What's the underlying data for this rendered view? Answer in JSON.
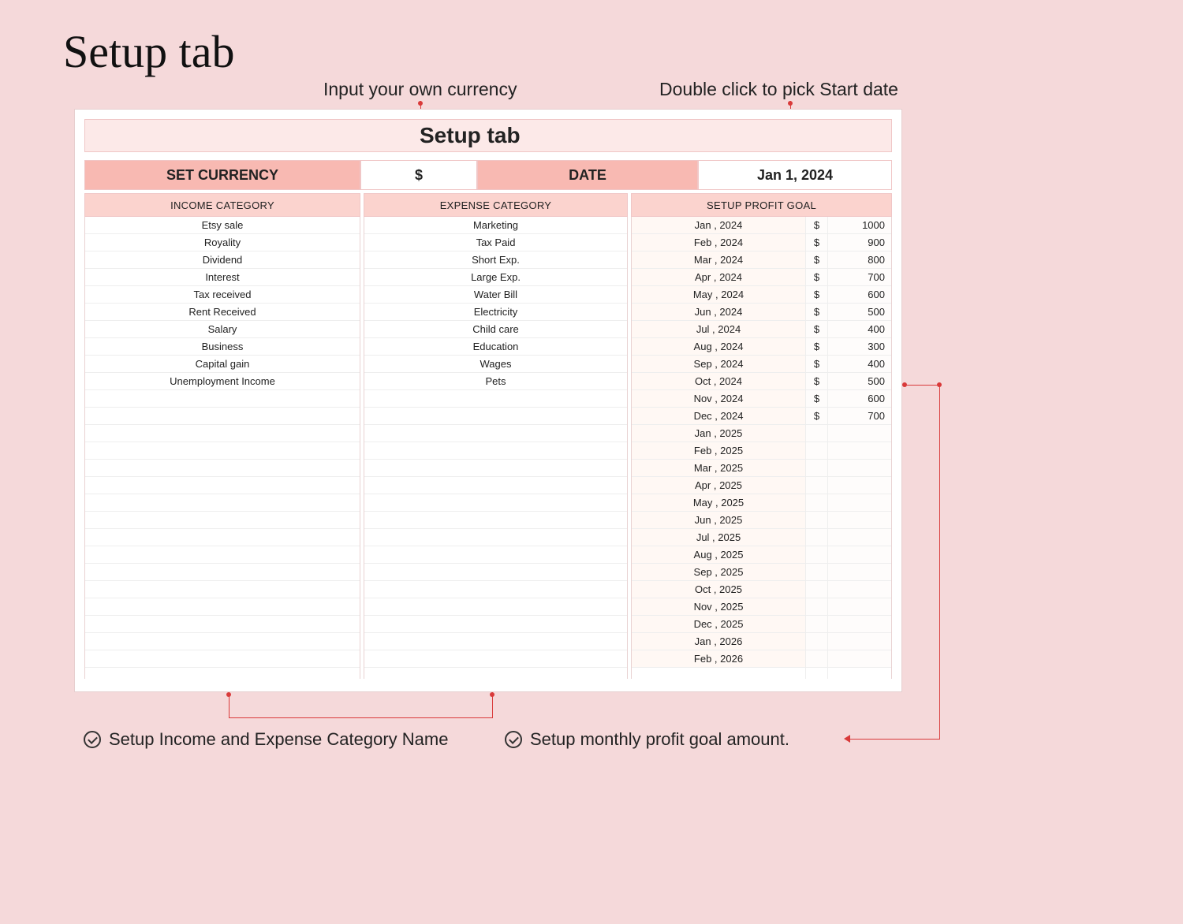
{
  "page_title": "Setup tab",
  "annotations": {
    "currency": "Input your own currency",
    "date": "Double click to pick Start date"
  },
  "titlebar": "Setup tab",
  "config": {
    "set_currency_label": "SET CURRENCY",
    "currency_value": "$",
    "date_label": "DATE",
    "date_value": "Jan 1, 2024"
  },
  "headers": {
    "income": "INCOME CATEGORY",
    "expense": "EXPENSE CATEGORY",
    "profit": "SETUP PROFIT GOAL"
  },
  "income_categories": [
    "Etsy sale",
    "Royality",
    "Dividend",
    "Interest",
    "Tax received",
    "Rent Received",
    "Salary",
    "Business",
    "Capital gain",
    "Unemployment Income",
    "",
    "",
    "",
    "",
    "",
    "",
    "",
    "",
    "",
    "",
    "",
    "",
    "",
    "",
    "",
    ""
  ],
  "expense_categories": [
    "Marketing",
    "Tax Paid",
    "Short Exp.",
    "Large Exp.",
    "Water Bill",
    "Electricity",
    "Child care",
    "Education",
    "Wages",
    "Pets",
    "",
    "",
    "",
    "",
    "",
    "",
    "",
    "",
    "",
    "",
    "",
    "",
    "",
    "",
    "",
    ""
  ],
  "profit_goals": [
    {
      "month": "Jan , 2024",
      "sym": "$",
      "value": "1000"
    },
    {
      "month": "Feb , 2024",
      "sym": "$",
      "value": "900"
    },
    {
      "month": "Mar , 2024",
      "sym": "$",
      "value": "800"
    },
    {
      "month": "Apr , 2024",
      "sym": "$",
      "value": "700"
    },
    {
      "month": "May , 2024",
      "sym": "$",
      "value": "600"
    },
    {
      "month": "Jun , 2024",
      "sym": "$",
      "value": "500"
    },
    {
      "month": "Jul , 2024",
      "sym": "$",
      "value": "400"
    },
    {
      "month": "Aug , 2024",
      "sym": "$",
      "value": "300"
    },
    {
      "month": "Sep , 2024",
      "sym": "$",
      "value": "400"
    },
    {
      "month": "Oct , 2024",
      "sym": "$",
      "value": "500"
    },
    {
      "month": "Nov , 2024",
      "sym": "$",
      "value": "600"
    },
    {
      "month": "Dec , 2024",
      "sym": "$",
      "value": "700"
    },
    {
      "month": "Jan , 2025",
      "sym": "",
      "value": ""
    },
    {
      "month": "Feb , 2025",
      "sym": "",
      "value": ""
    },
    {
      "month": "Mar , 2025",
      "sym": "",
      "value": ""
    },
    {
      "month": "Apr , 2025",
      "sym": "",
      "value": ""
    },
    {
      "month": "May , 2025",
      "sym": "",
      "value": ""
    },
    {
      "month": "Jun , 2025",
      "sym": "",
      "value": ""
    },
    {
      "month": "Jul , 2025",
      "sym": "",
      "value": ""
    },
    {
      "month": "Aug , 2025",
      "sym": "",
      "value": ""
    },
    {
      "month": "Sep , 2025",
      "sym": "",
      "value": ""
    },
    {
      "month": "Oct , 2025",
      "sym": "",
      "value": ""
    },
    {
      "month": "Nov , 2025",
      "sym": "",
      "value": ""
    },
    {
      "month": "Dec , 2025",
      "sym": "",
      "value": ""
    },
    {
      "month": "Jan , 2026",
      "sym": "",
      "value": ""
    },
    {
      "month": "Feb , 2026",
      "sym": "",
      "value": ""
    }
  ],
  "notes": {
    "left": "Setup Income and Expense Category Name",
    "right": "Setup monthly profit goal amount."
  }
}
